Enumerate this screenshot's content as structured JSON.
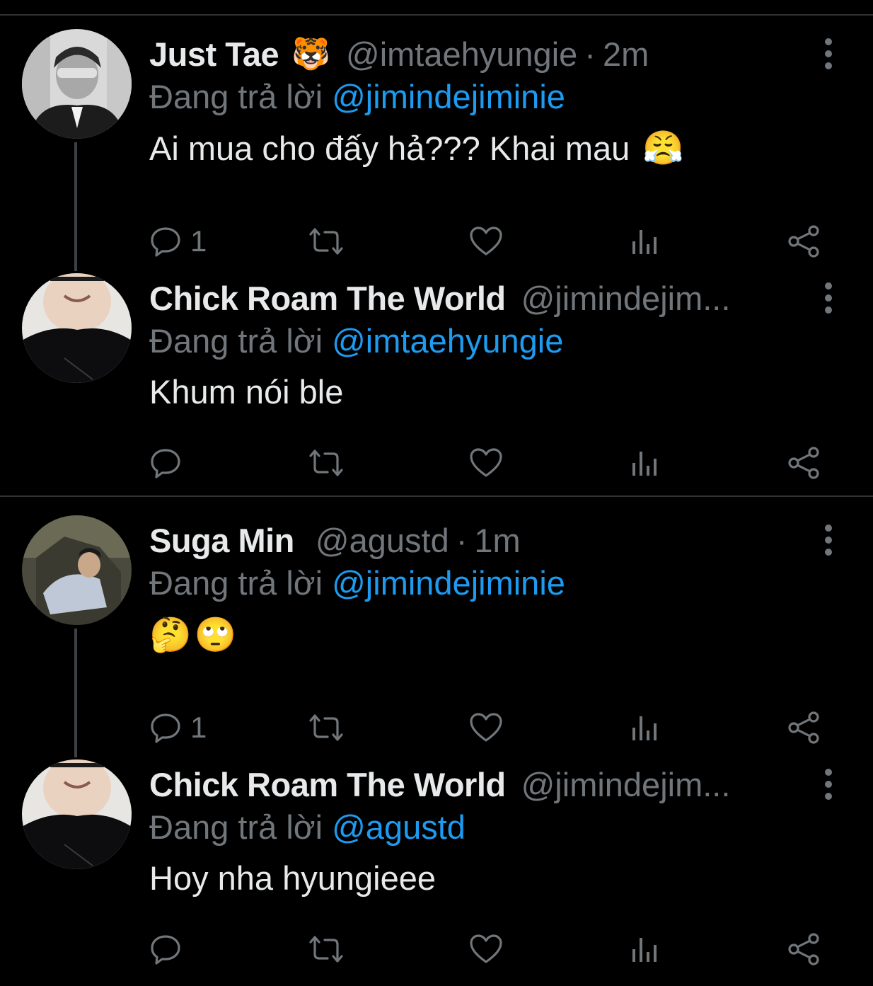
{
  "colors": {
    "background": "#000000",
    "text": "#e7e9ea",
    "muted": "#71767b",
    "mention": "#1d9bf0",
    "divider": "#2f3336"
  },
  "reply_prefix": "Đang trả lời",
  "tweets": [
    {
      "name": "Just Tae",
      "badge_icon": "tiger-face-emoji",
      "handle": "@imtaehyungie",
      "time": "2m",
      "reply_to": "@jimindejiminie",
      "text": "Ai mua cho đấy hả??? Khai mau",
      "text_emoji": "face-with-steam-emoji",
      "reply_count": "1"
    },
    {
      "name": "Chick Roam The World",
      "handle": "@jimindejim...",
      "reply_to": "@imtaehyungie",
      "text": "Khum nói ble",
      "reply_count": ""
    },
    {
      "name": "Suga Min",
      "handle": "@agustd",
      "time": "1m",
      "reply_to": "@jimindejiminie",
      "text": "",
      "text_emojis": [
        "thinking-face-emoji",
        "face-with-rolling-eyes-emoji"
      ],
      "reply_count": "1"
    },
    {
      "name": "Chick Roam The World",
      "handle": "@jimindejim...",
      "reply_to": "@agustd",
      "text": "Hoy nha hyungieee",
      "reply_count": ""
    }
  ]
}
